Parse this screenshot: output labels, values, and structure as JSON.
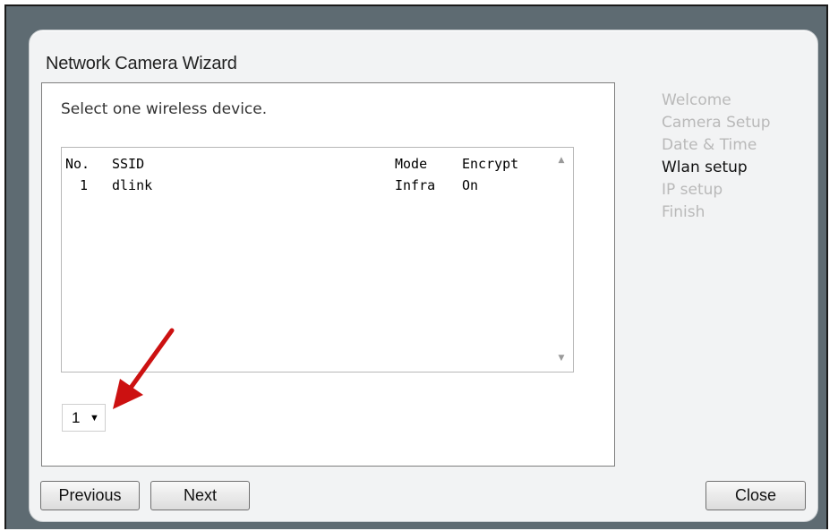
{
  "wizard": {
    "title": "Network Camera Wizard",
    "prompt": "Select one wireless device."
  },
  "device_list": {
    "columns": [
      "No.",
      "SSID",
      "Mode",
      "Encrypt"
    ],
    "rows": [
      {
        "no": "1",
        "ssid": "dlink",
        "mode": "Infra",
        "encrypt": "On"
      }
    ]
  },
  "selector": {
    "value": "1",
    "caret_icon": "caret-down-icon"
  },
  "steps": [
    {
      "label": "Welcome",
      "active": false
    },
    {
      "label": "Camera Setup",
      "active": false
    },
    {
      "label": "Date & Time",
      "active": false
    },
    {
      "label": "Wlan setup",
      "active": true
    },
    {
      "label": "IP setup",
      "active": false
    },
    {
      "label": "Finish",
      "active": false
    }
  ],
  "buttons": {
    "previous": "Previous",
    "next": "Next",
    "close": "Close"
  },
  "colors": {
    "frame": "#5e6b72",
    "arrow": "#cc1111",
    "inactive_step": "#b9b9b9"
  }
}
